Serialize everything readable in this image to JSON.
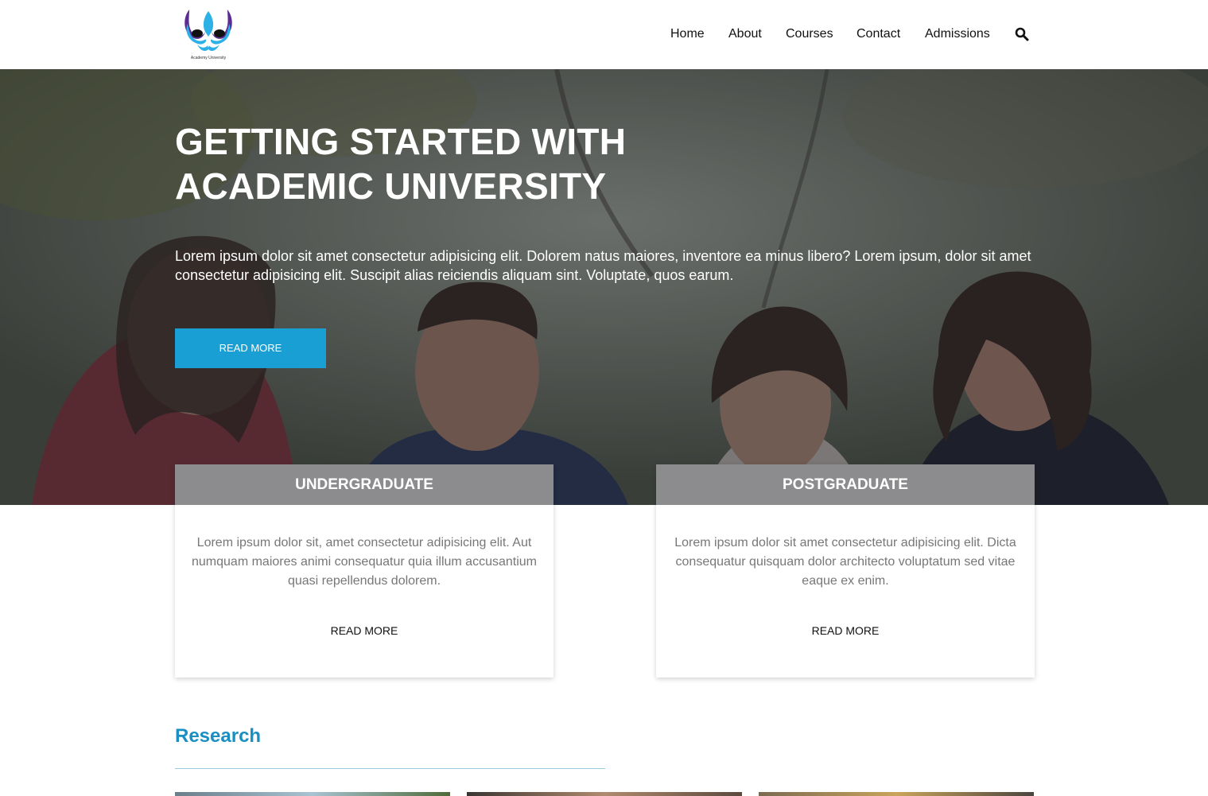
{
  "header": {
    "logo_caption": "Academy University",
    "nav": [
      "Home",
      "About",
      "Courses",
      "Contact",
      "Admissions"
    ],
    "search_icon": "search-icon"
  },
  "hero": {
    "title_line1": "GETTING STARTED WITH",
    "title_line2": "ACADEMIC UNIVERSITY",
    "text": "Lorem ipsum dolor sit amet consectetur adipisicing elit. Dolorem natus maiores, inventore ea minus libero? Lorem ipsum, dolor sit amet consectetur adipisicing elit. Suscipit alias reiciendis aliquam sint. Voluptate, quos earum.",
    "button": "READ MORE"
  },
  "cards": [
    {
      "title": "UNDERGRADUATE",
      "body": "Lorem ipsum dolor sit, amet consectetur adipisicing elit. Aut numquam maiores animi consequatur quia illum accusantium quasi repellendus dolorem.",
      "link": "READ MORE"
    },
    {
      "title": "POSTGRADUATE",
      "body": "Lorem ipsum dolor sit amet consectetur adipisicing elit. Dicta consequatur quisquam dolor architecto voluptatum sed vitae eaque ex enim.",
      "link": "READ MORE"
    }
  ],
  "research": {
    "title": "Research"
  },
  "colors": {
    "accent": "#1a9fd4",
    "heading": "#1a8fc1"
  }
}
